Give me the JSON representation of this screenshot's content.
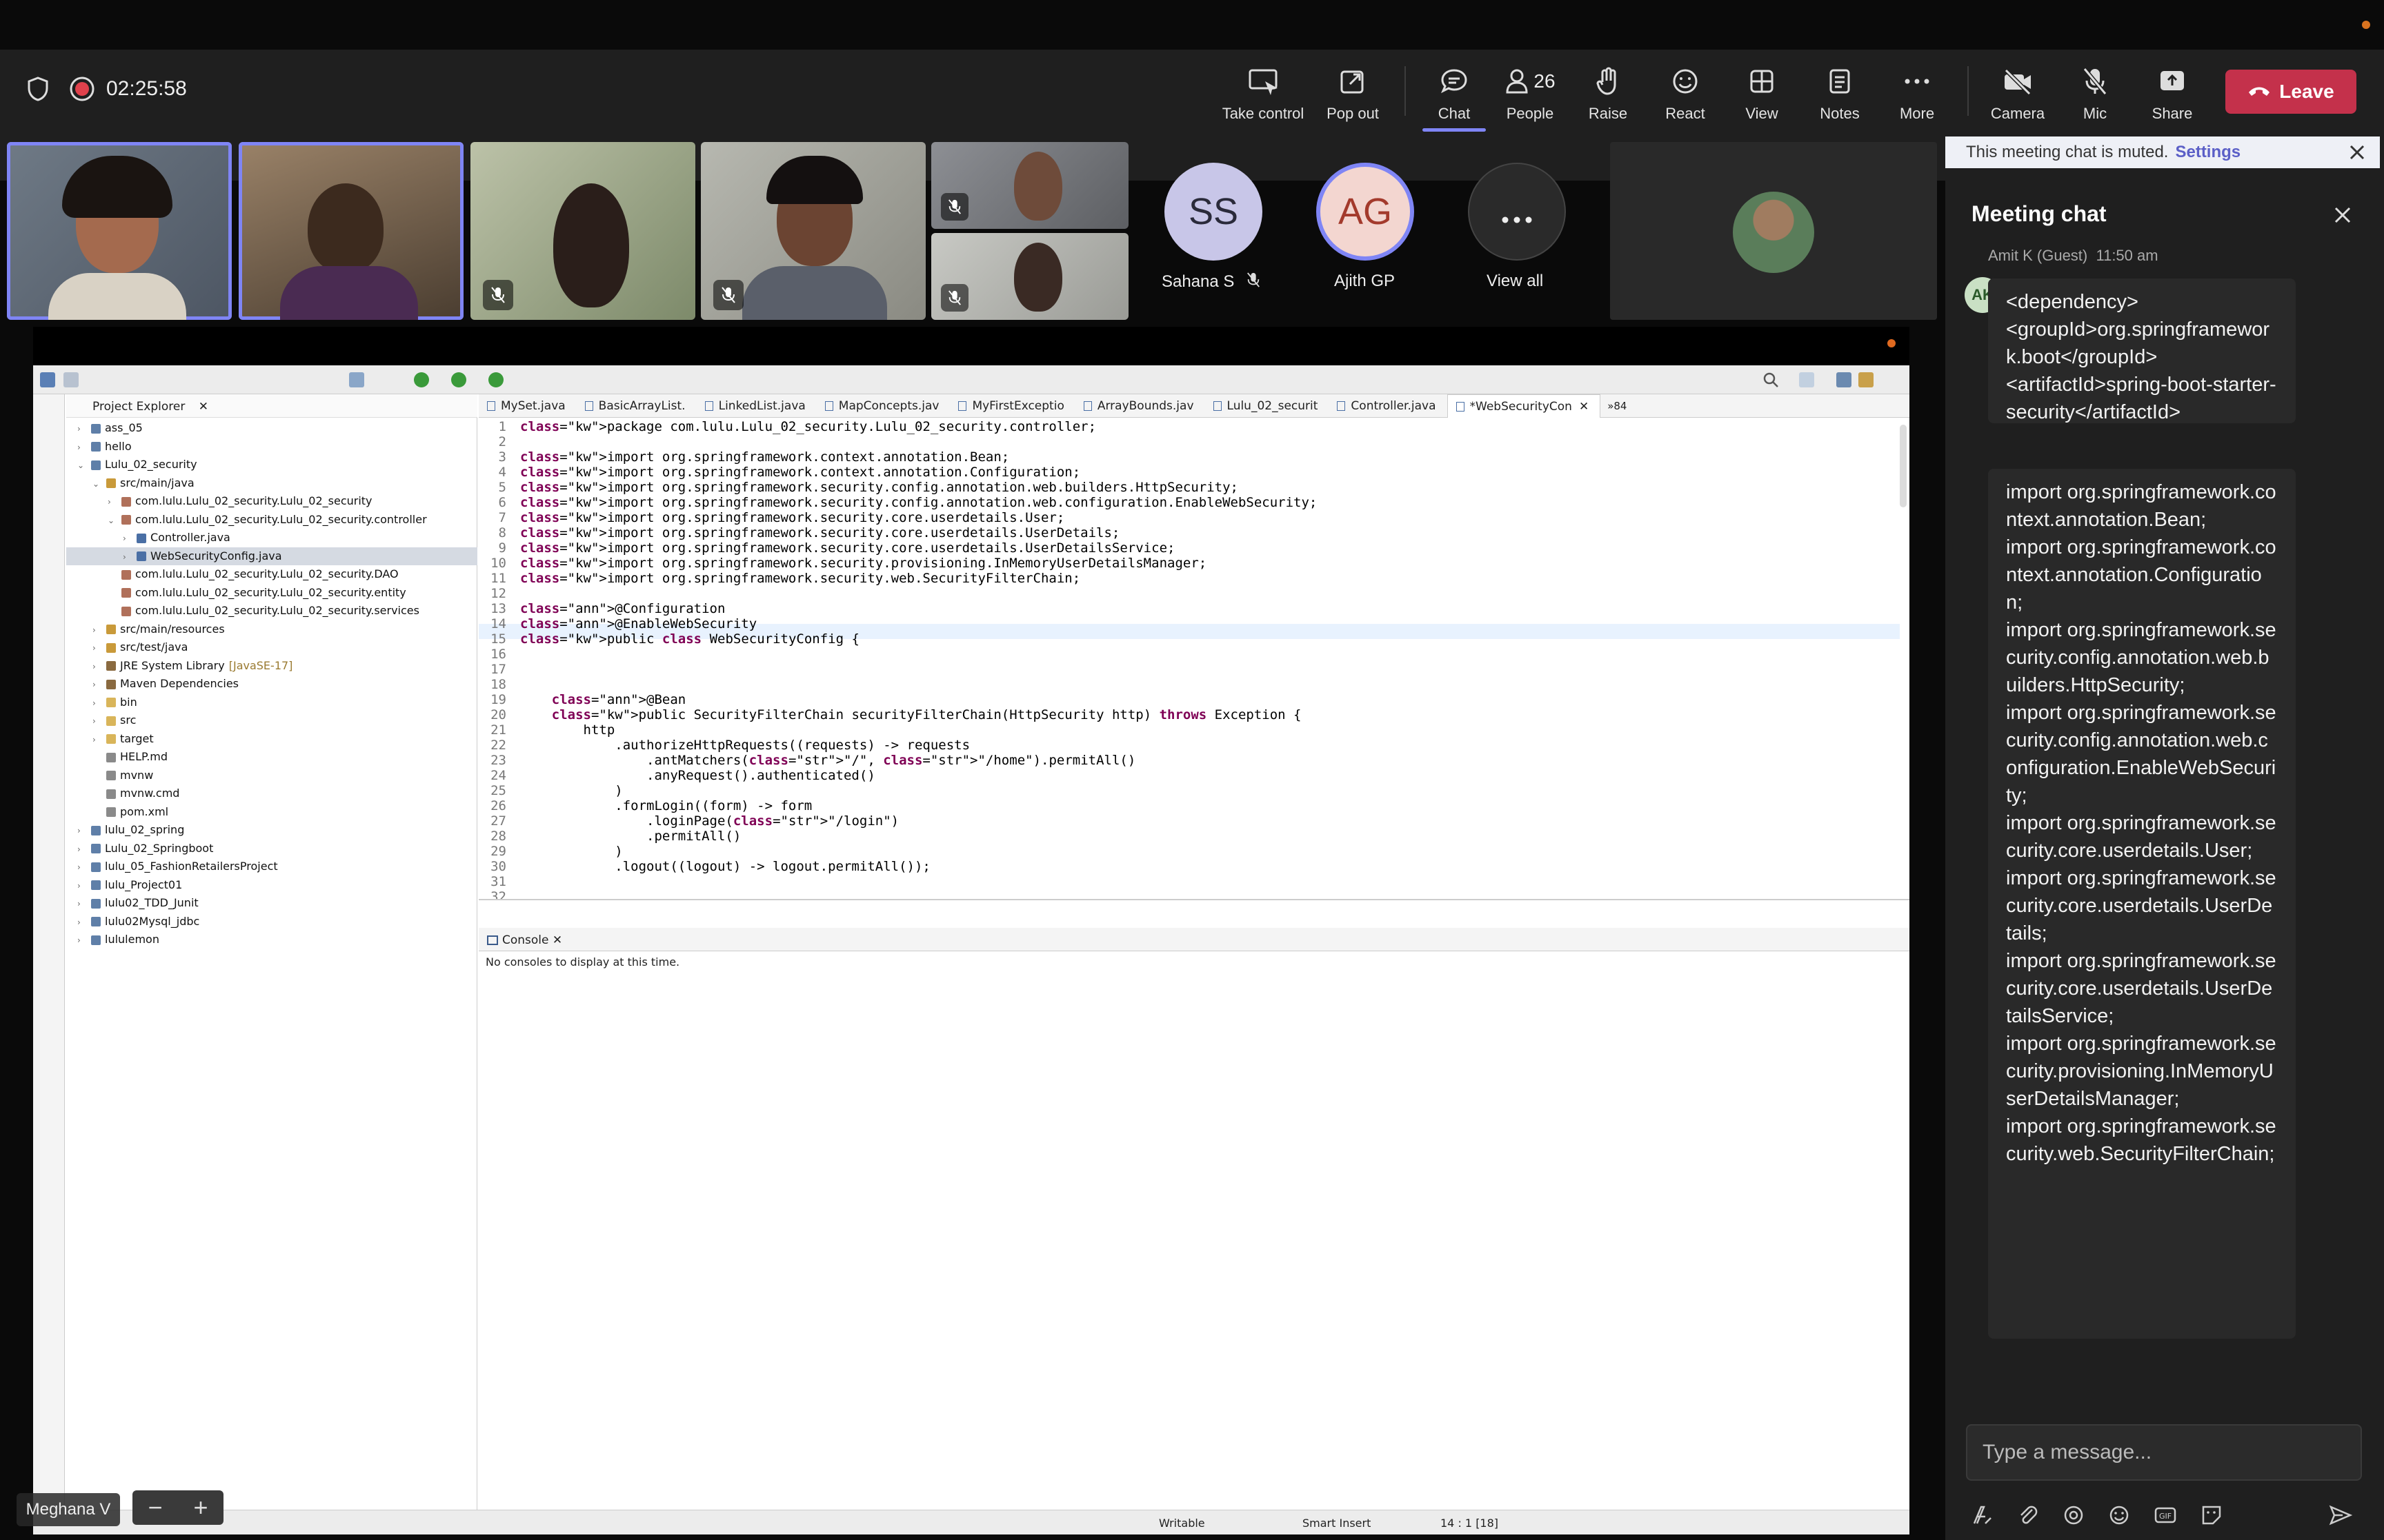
{
  "meeting": {
    "timer": "02:25:58",
    "toolbar": [
      {
        "id": "take-control",
        "label": "Take control",
        "icon": "take-control-icon"
      },
      {
        "id": "pop-out",
        "label": "Pop out",
        "icon": "pop-out-icon"
      },
      {
        "id": "chat",
        "label": "Chat",
        "icon": "chat-icon"
      },
      {
        "id": "people",
        "label": "People",
        "icon": "people-icon",
        "count": "26"
      },
      {
        "id": "raise",
        "label": "Raise",
        "icon": "raise-hand-icon"
      },
      {
        "id": "react",
        "label": "React",
        "icon": "react-icon"
      },
      {
        "id": "view",
        "label": "View",
        "icon": "view-icon"
      },
      {
        "id": "notes",
        "label": "Notes",
        "icon": "notes-icon"
      },
      {
        "id": "more",
        "label": "More",
        "icon": "more-icon"
      },
      {
        "id": "camera",
        "label": "Camera",
        "icon": "camera-off-icon"
      },
      {
        "id": "mic",
        "label": "Mic",
        "icon": "mic-off-icon"
      },
      {
        "id": "share",
        "label": "Share",
        "icon": "share-icon"
      }
    ],
    "leave_label": "Leave",
    "accent": "#7f85f5",
    "leave_color": "#c4314b"
  },
  "participants": {
    "sahana": {
      "initials": "SS",
      "name": "Sahana S"
    },
    "ajith": {
      "initials": "AG",
      "name": "Ajith GP"
    },
    "view_all": "View all",
    "presenter": "Meghana V"
  },
  "chat": {
    "muted_text": "This meeting chat is muted.",
    "settings_label": "Settings",
    "title": "Meeting chat",
    "sender": "Amit K (Guest)",
    "sender_time": "11:50 am",
    "sender_initials": "AK",
    "message1": "<dependency>\n<groupId>org.springframework.boot</groupId>\n<artifactId>spring-boot-starter-security</artifactId>\n</dependency>",
    "message2": "import org.springframework.context.annotation.Bean;\nimport org.springframework.context.annotation.Configuration;\nimport org.springframework.security.config.annotation.web.builders.HttpSecurity;\nimport org.springframework.security.config.annotation.web.configuration.EnableWebSecurity;\nimport org.springframework.security.core.userdetails.User;\nimport org.springframework.security.core.userdetails.UserDetails;\nimport org.springframework.security.core.userdetails.UserDetailsService;\nimport org.springframework.security.provisioning.InMemoryUserDetailsManager;\nimport org.springframework.security.web.SecurityFilterChain;",
    "input_placeholder": "Type a message..."
  },
  "ide": {
    "explorer_title": "Project Explorer",
    "tree": [
      {
        "depth": 0,
        "label": "ass_05",
        "icon": "project-icon",
        "arrow": "collapsed"
      },
      {
        "depth": 0,
        "label": "hello",
        "icon": "project-icon",
        "arrow": "collapsed"
      },
      {
        "depth": 0,
        "label": "Lulu_02_security",
        "icon": "project-icon",
        "arrow": "expanded"
      },
      {
        "depth": 1,
        "label": "src/main/java",
        "icon": "source-folder-icon",
        "arrow": "expanded"
      },
      {
        "depth": 2,
        "label": "com.lulu.Lulu_02_security.Lulu_02_security",
        "icon": "package-icon",
        "arrow": "collapsed"
      },
      {
        "depth": 2,
        "label": "com.lulu.Lulu_02_security.Lulu_02_security.controller",
        "icon": "package-icon",
        "arrow": "expanded"
      },
      {
        "depth": 3,
        "label": "Controller.java",
        "icon": "java-file-icon",
        "arrow": "collapsed"
      },
      {
        "depth": 3,
        "label": "WebSecurityConfig.java",
        "icon": "java-file-icon",
        "arrow": "collapsed",
        "selected": true
      },
      {
        "depth": 2,
        "label": "com.lulu.Lulu_02_security.Lulu_02_security.DAO",
        "icon": "package-icon",
        "arrow": "none"
      },
      {
        "depth": 2,
        "label": "com.lulu.Lulu_02_security.Lulu_02_security.entity",
        "icon": "package-icon",
        "arrow": "none"
      },
      {
        "depth": 2,
        "label": "com.lulu.Lulu_02_security.Lulu_02_security.services",
        "icon": "package-icon",
        "arrow": "none"
      },
      {
        "depth": 1,
        "label": "src/main/resources",
        "icon": "source-folder-icon",
        "arrow": "collapsed"
      },
      {
        "depth": 1,
        "label": "src/test/java",
        "icon": "source-folder-icon",
        "arrow": "collapsed"
      },
      {
        "depth": 1,
        "label": "JRE System Library",
        "suffix": "[JavaSE-17]",
        "icon": "library-icon",
        "arrow": "collapsed"
      },
      {
        "depth": 1,
        "label": "Maven Dependencies",
        "icon": "library-icon",
        "arrow": "collapsed"
      },
      {
        "depth": 1,
        "label": "bin",
        "icon": "folder-icon",
        "arrow": "collapsed"
      },
      {
        "depth": 1,
        "label": "src",
        "icon": "folder-icon",
        "arrow": "collapsed"
      },
      {
        "depth": 1,
        "label": "target",
        "icon": "folder-icon",
        "arrow": "collapsed"
      },
      {
        "depth": 1,
        "label": "HELP.md",
        "icon": "file-icon",
        "arrow": "none"
      },
      {
        "depth": 1,
        "label": "mvnw",
        "icon": "file-icon",
        "arrow": "none"
      },
      {
        "depth": 1,
        "label": "mvnw.cmd",
        "icon": "file-icon",
        "arrow": "none"
      },
      {
        "depth": 1,
        "label": "pom.xml",
        "icon": "file-icon",
        "arrow": "none"
      },
      {
        "depth": 0,
        "label": "lulu_02_spring",
        "icon": "project-icon",
        "arrow": "collapsed"
      },
      {
        "depth": 0,
        "label": "Lulu_02_Springboot",
        "icon": "project-icon",
        "arrow": "collapsed"
      },
      {
        "depth": 0,
        "label": "lulu_05_FashionRetailersProject",
        "icon": "project-icon",
        "arrow": "collapsed"
      },
      {
        "depth": 0,
        "label": "lulu_Project01",
        "icon": "project-icon",
        "arrow": "collapsed"
      },
      {
        "depth": 0,
        "label": "lulu02_TDD_Junit",
        "icon": "project-icon",
        "arrow": "collapsed"
      },
      {
        "depth": 0,
        "label": "lulu02Mysql_jdbc",
        "icon": "project-icon",
        "arrow": "collapsed"
      },
      {
        "depth": 0,
        "label": "lululemon",
        "icon": "project-icon",
        "arrow": "collapsed"
      }
    ],
    "tabs": [
      "MySet.java",
      "BasicArrayList.",
      "LinkedList.java",
      "MapConcepts.jav",
      "MyFirstExceptio",
      "ArrayBounds.jav",
      "Lulu_02_securit",
      "Controller.java",
      "*WebSecurityCon"
    ],
    "overflow_tabs": "84",
    "code": [
      "package com.lulu.Lulu_02_security.Lulu_02_security.controller;",
      "",
      "import org.springframework.context.annotation.Bean;",
      "import org.springframework.context.annotation.Configuration;",
      "import org.springframework.security.config.annotation.web.builders.HttpSecurity;",
      "import org.springframework.security.config.annotation.web.configuration.EnableWebSecurity;",
      "import org.springframework.security.core.userdetails.User;",
      "import org.springframework.security.core.userdetails.UserDetails;",
      "import org.springframework.security.core.userdetails.UserDetailsService;",
      "import org.springframework.security.provisioning.InMemoryUserDetailsManager;",
      "import org.springframework.security.web.SecurityFilterChain;",
      "",
      "@Configuration",
      "@EnableWebSecurity",
      "public class WebSecurityConfig {",
      "",
      "",
      "",
      "    @Bean",
      "    public SecurityFilterChain securityFilterChain(HttpSecurity http) throws Exception {",
      "        http",
      "            .authorizeHttpRequests((requests) -> requests",
      "                .antMatchers(\"/\", \"/home\").permitAll()",
      "                .anyRequest().authenticated()",
      "            )",
      "            .formLogin((form) -> form",
      "                .loginPage(\"/login\")",
      "                .permitAll()",
      "            )",
      "            .logout((logout) -> logout.permitAll());",
      "",
      "",
      ""
    ],
    "console_title": "Console",
    "console_message": "No consoles to display at this time.",
    "status_writable": "Writable",
    "status_insert": "Smart Insert",
    "status_position": "14 : 1 [18]"
  }
}
